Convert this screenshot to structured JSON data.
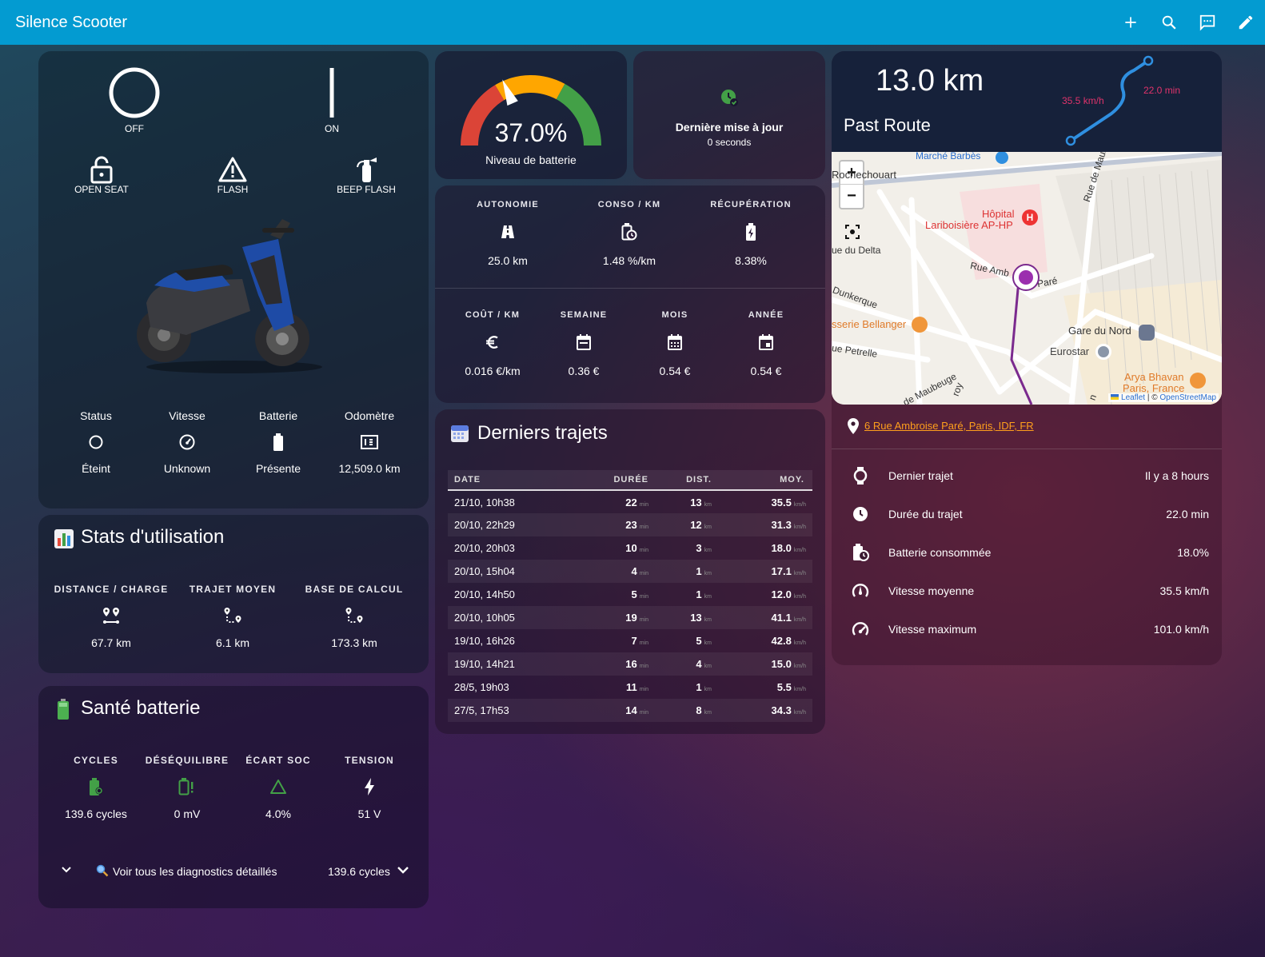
{
  "topbar": {
    "title": "Silence Scooter",
    "icons": [
      "plus-icon",
      "search-icon",
      "chat-icon",
      "pencil-icon"
    ]
  },
  "controls": {
    "power_off": {
      "label": "OFF",
      "icon": "power-off-icon"
    },
    "power_on": {
      "label": "ON",
      "icon": "power-on-icon"
    },
    "open_seat": {
      "label": "OPEN SEAT",
      "icon": "lock-open-icon"
    },
    "flash": {
      "label": "FLASH",
      "icon": "warning-triangle-icon"
    },
    "beep_flash": {
      "label": "BEEP FLASH",
      "icon": "fire-extinguisher-icon"
    }
  },
  "scooter_status": [
    {
      "label": "Status",
      "value": "Éteint",
      "icon": "circle-outline-icon"
    },
    {
      "label": "Vitesse",
      "value": "Unknown",
      "icon": "speedometer-icon"
    },
    {
      "label": "Batterie",
      "value": "Présente",
      "icon": "battery-icon"
    },
    {
      "label": "Odomètre",
      "value": "12,509.0 km",
      "icon": "counter-icon"
    }
  ],
  "battery_gauge": {
    "value_text": "37.0%",
    "value": 37.0,
    "label": "Niveau de batterie",
    "colors": {
      "red": "#db4437",
      "orange": "#ffa600",
      "green": "#43a047"
    }
  },
  "last_update": {
    "title": "Dernière mise à jour",
    "value": "0 seconds",
    "icon": "clock-check-icon",
    "color": "#43a047"
  },
  "metrics": [
    {
      "label": "AUTONOMIE",
      "value": "25.0 km",
      "icon": "road-icon"
    },
    {
      "label": "CONSO / KM",
      "value": "1.48 %/km",
      "icon": "battery-clock-icon"
    },
    {
      "label": "RÉCUPÉRATION",
      "value": "8.38%",
      "icon": "battery-charging-icon"
    }
  ],
  "costs": [
    {
      "label": "COÛT / KM",
      "value": "0.016 €/km",
      "icon": "euro-icon"
    },
    {
      "label": "SEMAINE",
      "value": "0.36 €",
      "icon": "calendar-week-icon"
    },
    {
      "label": "MOIS",
      "value": "0.54 €",
      "icon": "calendar-month-icon"
    },
    {
      "label": "ANNÉE",
      "value": "0.54 €",
      "icon": "calendar-today-icon"
    }
  ],
  "usage_stats": {
    "title": "Stats d'utilisation",
    "icon": "bar-chart-icon",
    "items": [
      {
        "label": "DISTANCE / CHARGE",
        "value": "67.7 km",
        "icon": "map-marker-distance-icon"
      },
      {
        "label": "TRAJET MOYEN",
        "value": "6.1 km",
        "icon": "map-marker-path-icon"
      },
      {
        "label": "BASE DE CALCUL",
        "value": "173.3 km",
        "icon": "map-marker-path-icon"
      }
    ]
  },
  "battery_health": {
    "title": "Santé batterie",
    "icon": "battery-emoji-icon",
    "items": [
      {
        "label": "CYCLES",
        "value": "139.6 cycles",
        "icon": "battery-sync-icon",
        "color": "#43a047"
      },
      {
        "label": "DÉSÉQUILIBRE",
        "value": "0 mV",
        "icon": "battery-alert-icon",
        "color": "#43a047"
      },
      {
        "label": "ÉCART SOC",
        "value": "4.0%",
        "icon": "triangle-outline-icon",
        "color": "#43a047"
      },
      {
        "label": "TENSION",
        "value": "51 V",
        "icon": "flash-icon",
        "color": "#ffffff"
      }
    ],
    "footer": {
      "text": "Voir tous les diagnostics détaillés",
      "value": "139.6 cycles",
      "icon": "magnifier-emoji-icon"
    }
  },
  "trips": {
    "title": "Derniers trajets",
    "icon": "calendar-emoji-icon",
    "columns": [
      "DATE",
      "DURÉE",
      "DIST.",
      "MOY."
    ],
    "units": {
      "duration": "min",
      "distance": "km",
      "speed": "km/h"
    },
    "rows": [
      {
        "date": "21/10, 10h38",
        "duration": "22",
        "dist": "13",
        "avg": "35.5"
      },
      {
        "date": "20/10, 22h29",
        "duration": "23",
        "dist": "12",
        "avg": "31.3"
      },
      {
        "date": "20/10, 20h03",
        "duration": "10",
        "dist": "3",
        "avg": "18.0"
      },
      {
        "date": "20/10, 15h04",
        "duration": "4",
        "dist": "1",
        "avg": "17.1"
      },
      {
        "date": "20/10, 14h50",
        "duration": "5",
        "dist": "1",
        "avg": "12.0"
      },
      {
        "date": "20/10, 10h05",
        "duration": "19",
        "dist": "13",
        "avg": "41.1"
      },
      {
        "date": "19/10, 16h26",
        "duration": "7",
        "dist": "5",
        "avg": "42.8"
      },
      {
        "date": "19/10, 14h21",
        "duration": "16",
        "dist": "4",
        "avg": "15.0"
      },
      {
        "date": "28/5, 19h03",
        "duration": "11",
        "dist": "1",
        "avg": "5.5"
      },
      {
        "date": "27/5, 17h53",
        "duration": "14",
        "dist": "8",
        "avg": "34.3"
      }
    ]
  },
  "route": {
    "distance": "13.0 km",
    "title": "Past Route",
    "speed_label": "35.5 km/h",
    "duration_label": "22.0 min",
    "colors": {
      "route": "#2f8fe0",
      "accent": "#e0336b"
    }
  },
  "map": {
    "zoom_in": "+",
    "zoom_out": "−",
    "attribution_leaflet": "Leaflet",
    "attribution_sep": "| ©",
    "attribution_osm": "OpenStreetMap",
    "labels": {
      "marche": "Marché Barbès",
      "rochechouart": "Rochechouart",
      "hopital1": "Hôpital",
      "hopital2": "Lariboisière AP-HP",
      "delta": "ue du Delta",
      "maubeuge": "Rue de Maubeuge",
      "ambroise": "Rue Amb",
      "pare": "Paré",
      "dunkerque": "Dunkerque",
      "bellanger": "sserie Bellanger",
      "petrelle": "ue Petrelle",
      "gare": "Gare du Nord",
      "eurostar": "Eurostar",
      "arya1": "Arya Bhavan",
      "arya2": "Paris, France",
      "maubeuge2": "de Maubeuge",
      "roy": "roy",
      "n": "n"
    }
  },
  "address": {
    "text": "6 Rue Ambroise Paré, Paris, IDF, FR",
    "icon": "map-marker-icon",
    "color": "#ff9f1c"
  },
  "trip_details": [
    {
      "label": "Dernier trajet",
      "value": "Il y a 8 hours",
      "icon": "watch-icon"
    },
    {
      "label": "Durée du trajet",
      "value": "22.0 min",
      "icon": "clock-icon"
    },
    {
      "label": "Batterie consommée",
      "value": "18.0%",
      "icon": "battery-clock-icon"
    },
    {
      "label": "Vitesse moyenne",
      "value": "35.5 km/h",
      "icon": "speedometer-medium-icon"
    },
    {
      "label": "Vitesse maximum",
      "value": "101.0 km/h",
      "icon": "speedometer-icon"
    }
  ]
}
